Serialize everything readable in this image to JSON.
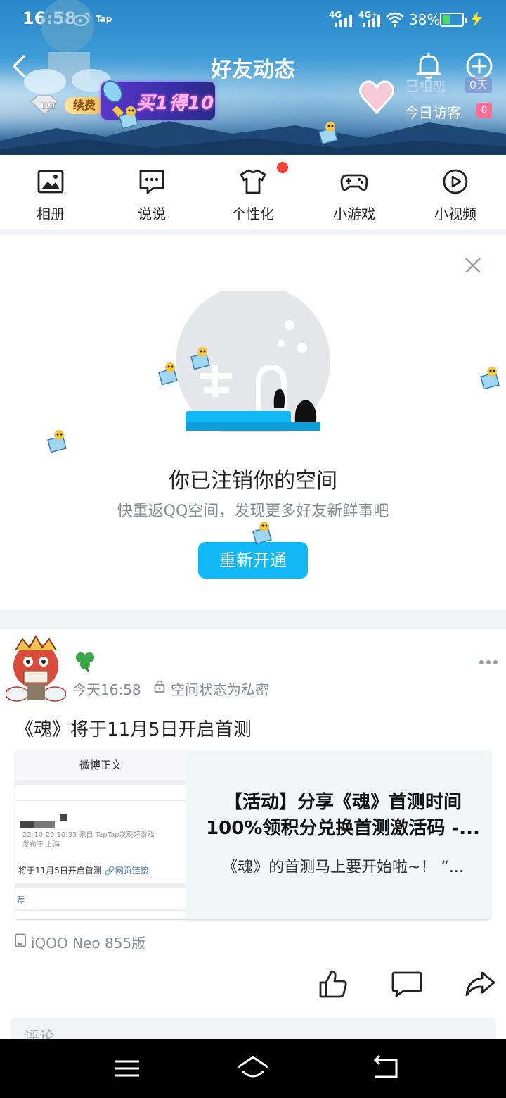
{
  "status_bar": {
    "time": "16:58",
    "app_marker": "Tap",
    "net1": "4G",
    "net2": "4G+",
    "battery": "38%",
    "battery_level": 0.38
  },
  "header": {
    "title": "好友动态",
    "level": "LV1",
    "renew_label": "续费",
    "vip_promo": "买1得10",
    "couple_label": "已相恋",
    "couple_days": "0天",
    "visitors_label": "今日访客",
    "visitors_count": "0"
  },
  "quick_actions": [
    {
      "label": "相册",
      "icon": "album-icon"
    },
    {
      "label": "说说",
      "icon": "chat-bubble-icon"
    },
    {
      "label": "个性化",
      "icon": "tshirt-icon"
    },
    {
      "label": "小游戏",
      "icon": "gamepad-icon"
    },
    {
      "label": "小视频",
      "icon": "play-icon"
    }
  ],
  "closed_space": {
    "title": "你已注销你的空间",
    "subtitle": "快重返QQ空间，发现更多好友新鲜事吧",
    "button": "重新开通"
  },
  "post": {
    "time": "今天16:58",
    "privacy": "空间状态为私密",
    "text": "《魂》将于11月5日开启首测",
    "share": {
      "thumb_header": "微博正文",
      "thumb_meta1": "22-10-29 10:33  来自 TapTap发现好游戏",
      "thumb_meta2": "发布于 上海",
      "thumb_line": "将于11月5日开启首测",
      "thumb_link": "网页链接",
      "thumb_rec": "荐",
      "title": "【活动】分享《魂》首测时间100%领积分兑换首测激活码 -...",
      "desc": "《魂》的首测马上要开始啦~！ “..."
    },
    "device": "iQOO Neo 855版",
    "comment_placeholder": "评论"
  },
  "colors": {
    "accent": "#12b7f5",
    "badge_red": "#f04236",
    "visitor_badge": "#ff6c94",
    "muted_text": "#8a8d95"
  }
}
